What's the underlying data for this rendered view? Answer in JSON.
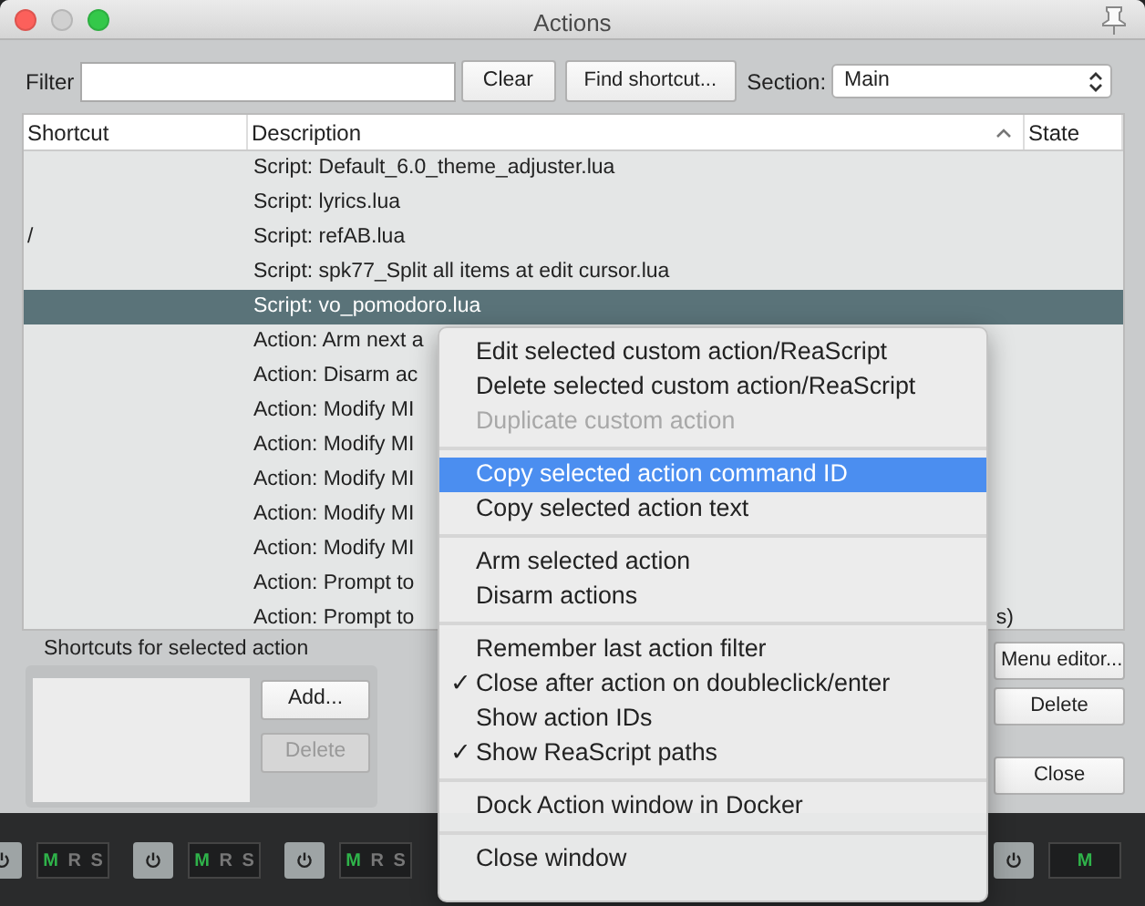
{
  "window": {
    "title": "Actions"
  },
  "toolbar": {
    "filter_label": "Filter",
    "clear_button": "Clear",
    "find_button": "Find shortcut...",
    "section_label": "Section:",
    "section_value": "Main"
  },
  "table": {
    "columns": [
      {
        "label": "Shortcut",
        "sort": false
      },
      {
        "label": "Description",
        "sort": true
      },
      {
        "label": "State",
        "sort": false
      }
    ],
    "rows": [
      {
        "description": "Script: Default_6.0_theme_adjuster.lua",
        "selected": false
      },
      {
        "description": "Script: lyrics.lua",
        "selected": false
      },
      {
        "shortcut": "/",
        "description": "Script: refAB.lua",
        "selected": false
      },
      {
        "description": "Script: spk77_Split all items at edit cursor.lua",
        "selected": false
      },
      {
        "description": "Script: vo_pomodoro.lua",
        "selected": true
      },
      {
        "description": "Action: Arm next a",
        "selected": false
      },
      {
        "description": "Action: Disarm ac",
        "selected": false
      },
      {
        "description": "Action: Modify MI",
        "selected": false
      },
      {
        "description": "Action: Modify MI",
        "selected": false
      },
      {
        "description": "Action: Modify MI",
        "selected": false
      },
      {
        "description": "Action: Modify MI",
        "selected": false
      },
      {
        "description": "Action: Modify MI",
        "selected": false
      },
      {
        "description": "Action: Prompt to",
        "selected": false
      },
      {
        "description": "Action: Prompt to",
        "tail": "s)",
        "selected": false
      }
    ]
  },
  "shortcuts_panel": {
    "title": "Shortcuts for selected action",
    "add_button": {
      "label": "Add...",
      "disabled": false
    },
    "delete_button": {
      "label": "Delete",
      "disabled": true
    }
  },
  "side_buttons": [
    {
      "label": "Menu editor..."
    },
    {
      "label": "Delete"
    },
    {
      "label": "Close"
    }
  ],
  "context_menu": [
    {
      "kind": "item",
      "label": "Edit selected custom action/ReaScript",
      "disabled": false,
      "checked": false,
      "selected": false
    },
    {
      "kind": "item",
      "label": "Delete selected custom action/ReaScript",
      "disabled": false,
      "checked": false,
      "selected": false
    },
    {
      "kind": "item",
      "label": "Duplicate custom action",
      "disabled": true,
      "checked": false,
      "selected": false
    },
    {
      "kind": "separator"
    },
    {
      "kind": "item",
      "label": "Copy selected action command ID",
      "disabled": false,
      "checked": false,
      "selected": true
    },
    {
      "kind": "item",
      "label": "Copy selected action text",
      "disabled": false,
      "checked": false,
      "selected": false
    },
    {
      "kind": "separator"
    },
    {
      "kind": "item",
      "label": "Arm selected action",
      "disabled": false,
      "checked": false,
      "selected": false
    },
    {
      "kind": "item",
      "label": "Disarm actions",
      "disabled": false,
      "checked": false,
      "selected": false
    },
    {
      "kind": "separator"
    },
    {
      "kind": "item",
      "label": "Remember last action filter",
      "disabled": false,
      "checked": false,
      "selected": false
    },
    {
      "kind": "item",
      "label": "Close after action on doubleclick/enter",
      "disabled": false,
      "checked": true,
      "selected": false
    },
    {
      "kind": "item",
      "label": "Show action IDs",
      "disabled": false,
      "checked": false,
      "selected": false
    },
    {
      "kind": "item",
      "label": "Show ReaScript paths",
      "disabled": false,
      "checked": true,
      "selected": false
    },
    {
      "kind": "separator"
    },
    {
      "kind": "item",
      "label": "Dock Action window in Docker",
      "disabled": false,
      "checked": false,
      "selected": false
    },
    {
      "kind": "separator"
    },
    {
      "kind": "item",
      "label": "Close window",
      "disabled": false,
      "checked": false,
      "selected": false
    }
  ],
  "check_mark": "✓",
  "mixer": {
    "strips": [
      {
        "labels": [
          {
            "text": "M",
            "lit": true
          },
          {
            "text": "R",
            "lit": false
          },
          {
            "text": "S",
            "lit": false
          }
        ]
      },
      {
        "labels": [
          {
            "text": "M",
            "lit": true
          },
          {
            "text": "R",
            "lit": false
          },
          {
            "text": "S",
            "lit": false
          }
        ]
      },
      {
        "labels": [
          {
            "text": "M",
            "lit": true
          },
          {
            "text": "R",
            "lit": false
          },
          {
            "text": "S",
            "lit": false
          }
        ]
      },
      {
        "labels": [
          {
            "text": "M",
            "lit": true
          }
        ]
      }
    ]
  }
}
